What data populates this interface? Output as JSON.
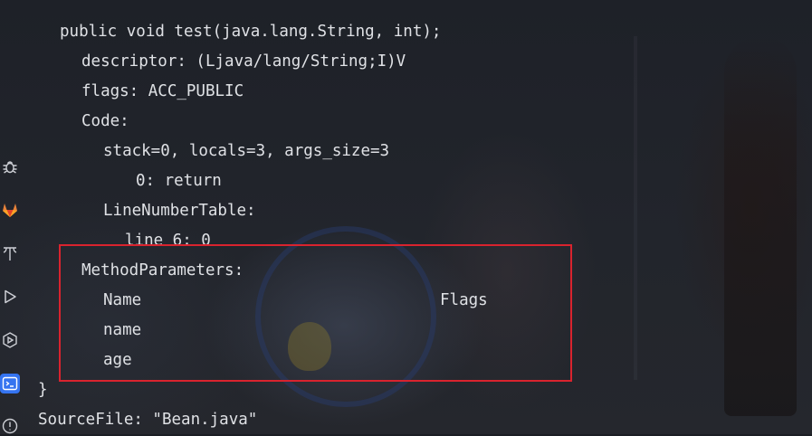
{
  "terminal": {
    "lines": [
      "public void test(java.lang.String, int);",
      "descriptor: (Ljava/lang/String;I)V",
      "flags: ACC_PUBLIC",
      "Code:",
      "stack=0, locals=3, args_size=3",
      "0: return",
      "LineNumberTable:",
      "line 6: 0",
      "MethodParameters:",
      "Name",
      "Flags",
      "name",
      "age",
      "}",
      "SourceFile: \"Bean.java\""
    ]
  },
  "toolbar": {
    "icons": [
      "bug-icon",
      "gitlab-icon",
      "build-tools-icon",
      "run-icon",
      "services-icon",
      "terminal-icon",
      "problems-icon"
    ],
    "active": "terminal-icon"
  },
  "colors": {
    "text": "#dfe1e5",
    "highlight_border": "#d9232e",
    "active_tool": "#3574f0"
  }
}
